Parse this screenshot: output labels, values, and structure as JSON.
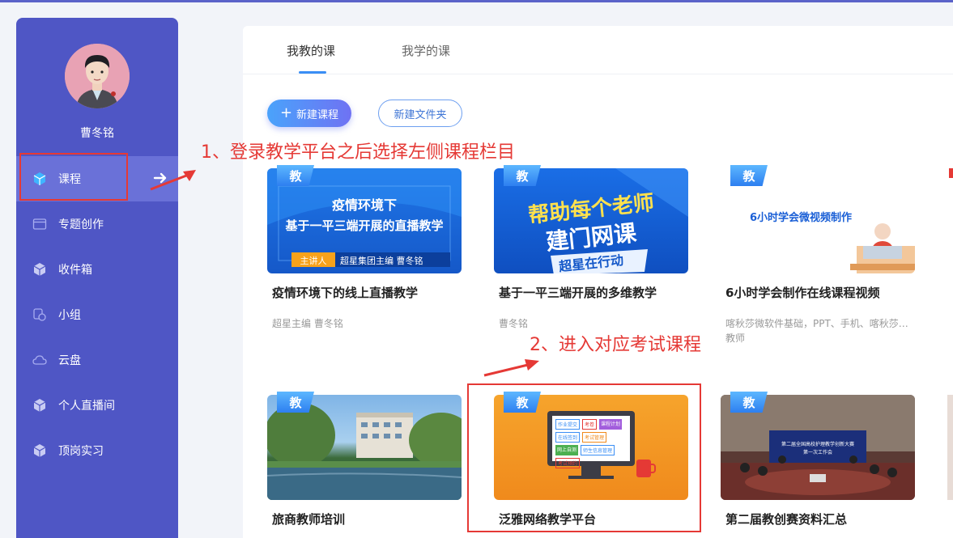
{
  "user": {
    "name": "曹冬铭"
  },
  "sidebar": {
    "items": [
      {
        "label": "课程",
        "icon": "course-cube-icon",
        "active": true
      },
      {
        "label": "专题创作",
        "icon": "topic-window-icon"
      },
      {
        "label": "收件箱",
        "icon": "inbox-cube-icon"
      },
      {
        "label": "小组",
        "icon": "group-icon"
      },
      {
        "label": "云盘",
        "icon": "cloud-icon"
      },
      {
        "label": "个人直播间",
        "icon": "live-cube-icon"
      },
      {
        "label": "顶岗实习",
        "icon": "internship-cube-icon"
      }
    ]
  },
  "tabs": [
    {
      "label": "我教的课",
      "active": true
    },
    {
      "label": "我学的课",
      "active": false
    }
  ],
  "toolbar": {
    "new_course": "新建课程",
    "new_folder": "新建文件夹"
  },
  "courses": [
    {
      "badge": "教",
      "title": "疫情环境下的线上直播教学",
      "sub": "超星主编 曹冬铭",
      "thumb": {
        "line1": "疫情环境下",
        "line2": "基于一平三端开展的直播教学",
        "tag": "主讲人",
        "tag_text": "超星集团主编  曹冬铭"
      }
    },
    {
      "badge": "教",
      "title": "基于一平三端开展的多维教学",
      "sub": "曹冬铭",
      "thumb": {
        "line1": "帮助每个老师",
        "line2": "建门网课",
        "line3": "超星在行动"
      }
    },
    {
      "badge": "教",
      "title": "6小时学会制作在线课程视频",
      "sub": "喀秋莎微软件基础，PPT、手机、喀秋莎…",
      "sub2": "教师",
      "thumb": {
        "line1": "6小时学会微视频制作"
      }
    },
    {
      "badge": "教",
      "title": "旅商教师培训",
      "sub": ""
    },
    {
      "badge": "教",
      "title": "泛雅网络教学平台",
      "sub": "",
      "thumb": {
        "chips": [
          "作业提交",
          "考卷",
          "课程计划",
          "在线签到",
          "考试管理",
          "网上自测",
          "师生信息管理",
          "考试预约"
        ]
      }
    },
    {
      "badge": "教",
      "title": "第二届教创赛资料汇总",
      "sub": "",
      "thumb": {
        "banner": "第二届全国高校护理教学创新大赛",
        "banner2": "第一次工作会"
      }
    }
  ],
  "annotations": {
    "step1": "1、登录教学平台之后选择左侧课程栏目",
    "step2": "2、进入对应考试课程"
  },
  "colors": {
    "sidebar": "#4f56c5",
    "accent": "#3a8ef5",
    "annotation": "#e53935"
  }
}
